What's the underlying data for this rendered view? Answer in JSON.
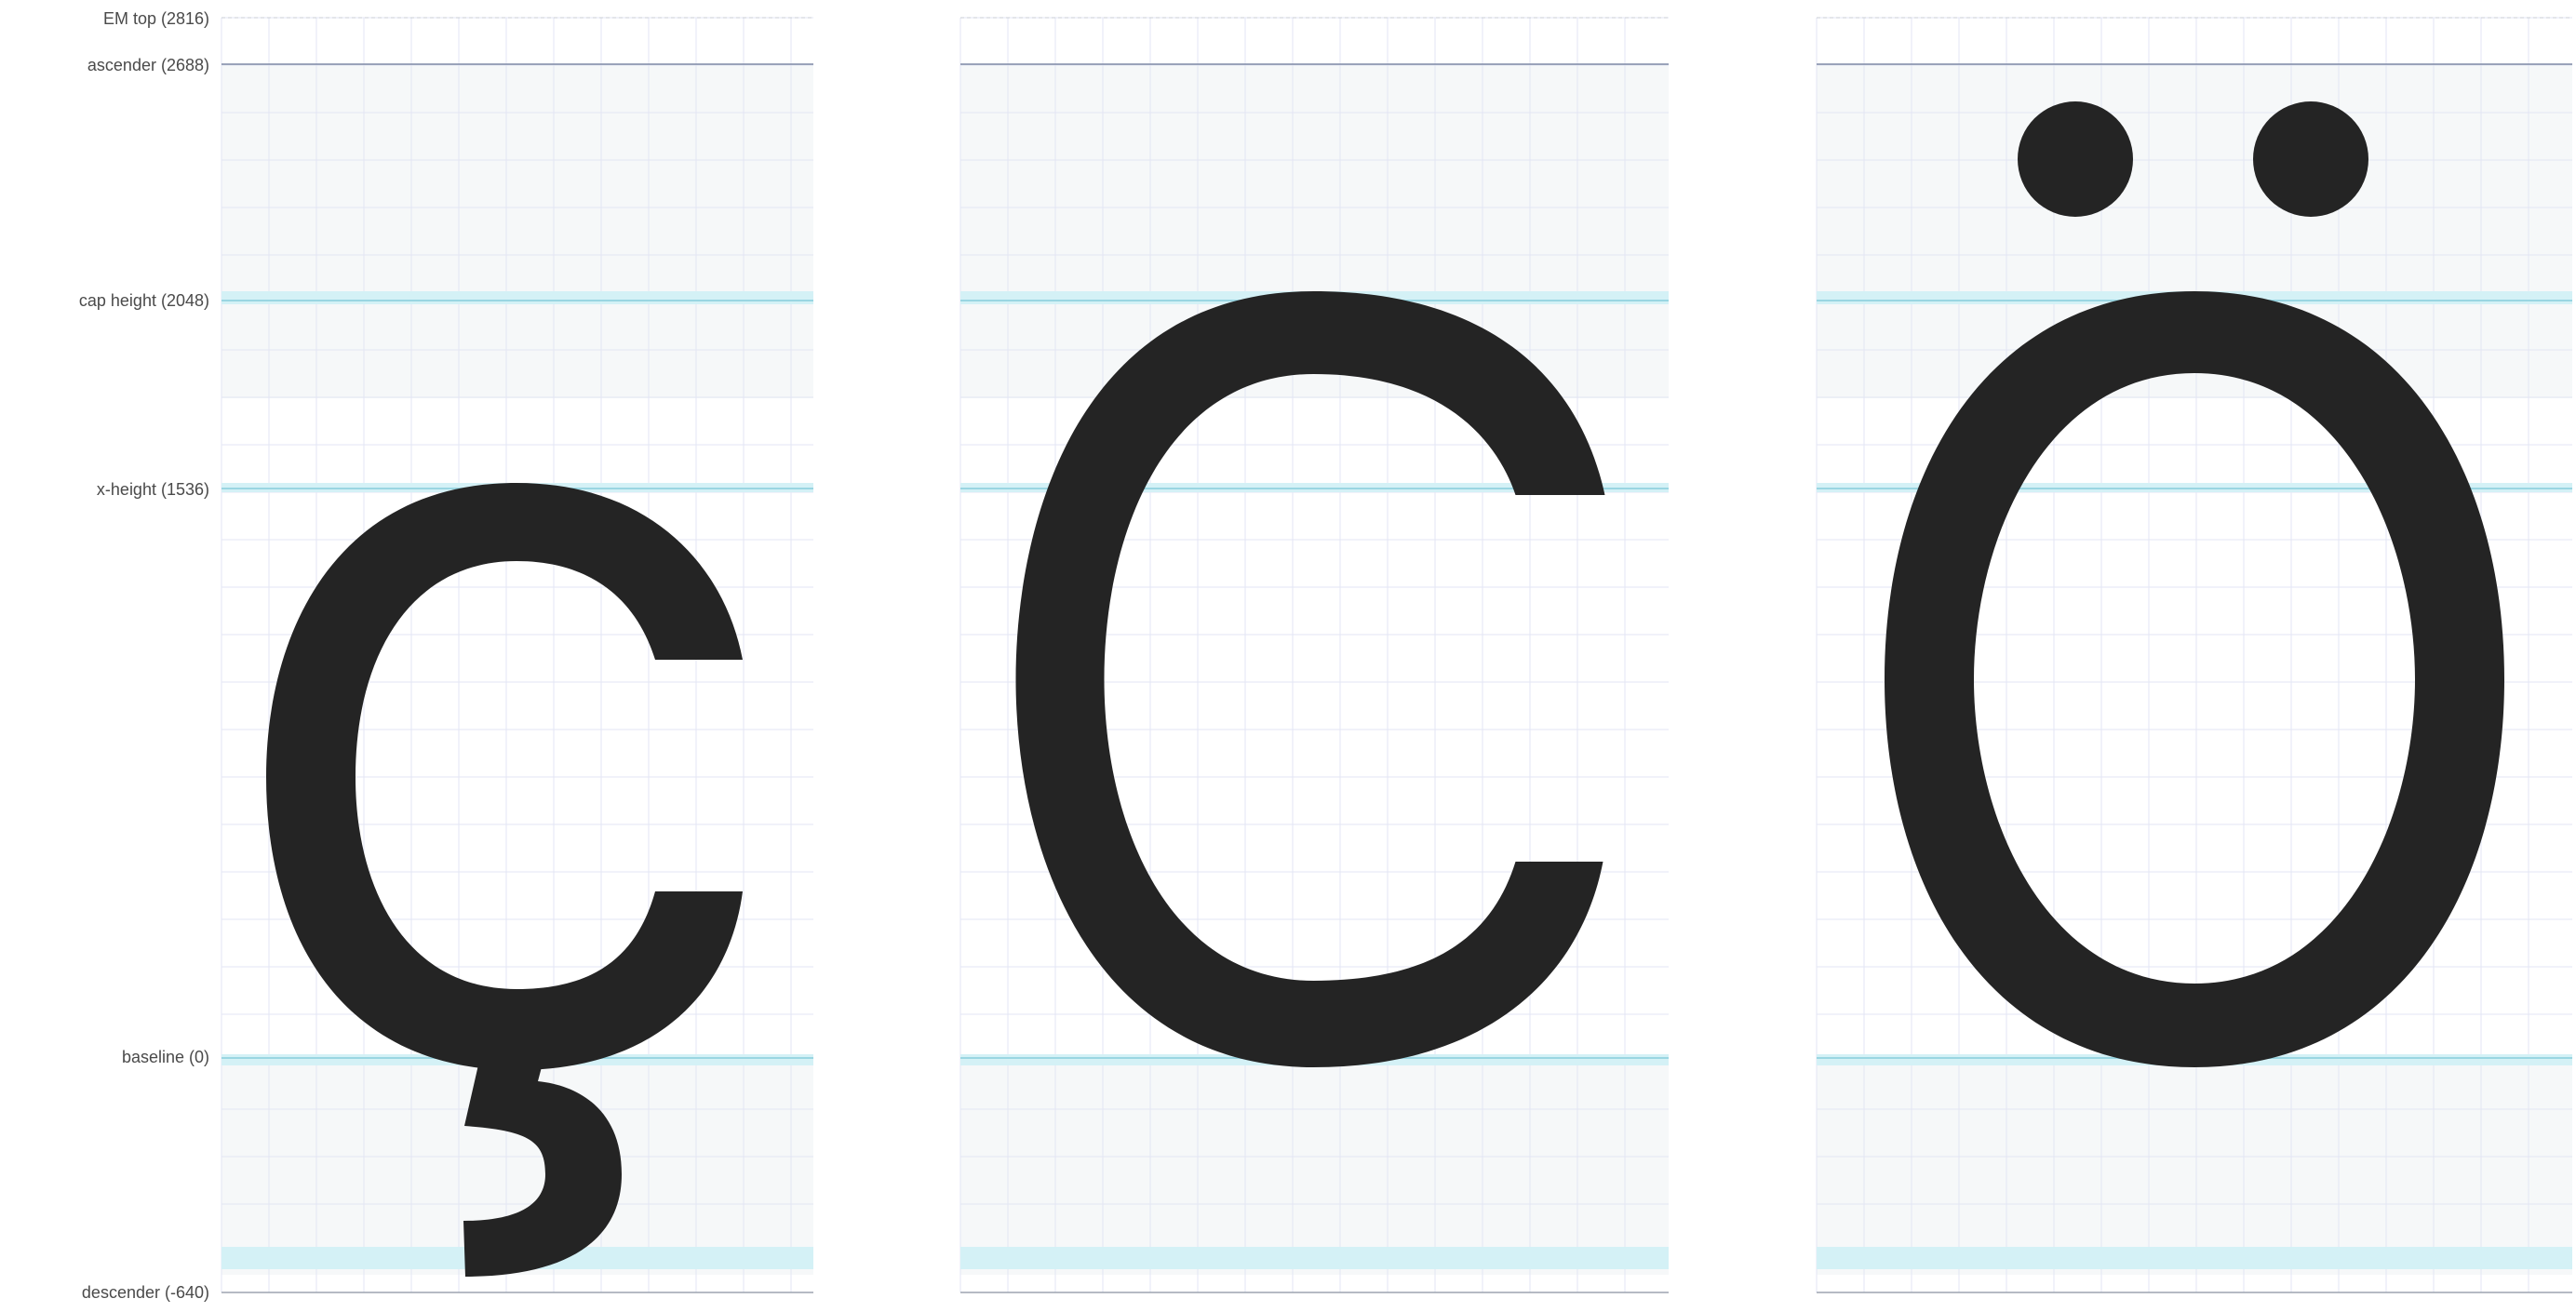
{
  "metrics": [
    {
      "key": "em_top",
      "label": "EM top (2816)",
      "value": 2816
    },
    {
      "key": "ascender",
      "label": "ascender (2688)",
      "value": 2688
    },
    {
      "key": "cap_height",
      "label": "cap height (2048)",
      "value": 2048
    },
    {
      "key": "x_height",
      "label": "x-height (1536)",
      "value": 1536
    },
    {
      "key": "baseline",
      "label": "baseline (0)",
      "value": 0
    },
    {
      "key": "descender",
      "label": "descender (-640)",
      "value": -640
    }
  ],
  "glyphs": [
    {
      "name": "c-cedilla",
      "char": "ç"
    },
    {
      "name": "capital-c",
      "char": "C"
    },
    {
      "name": "o-diaeresis",
      "char": "Ö"
    }
  ],
  "colors": {
    "glyph": "#242424",
    "metric_highlight": "#d4f1f6",
    "metric_line": "#9ad6e2",
    "em_line": "#c8cdd4",
    "ascender_line": "#7f8aa5",
    "descender_line": "#9ea4b0",
    "grid": "#e3e6f4",
    "zone_fill": "#f6f8f9",
    "label_text": "#4a4a4a"
  }
}
